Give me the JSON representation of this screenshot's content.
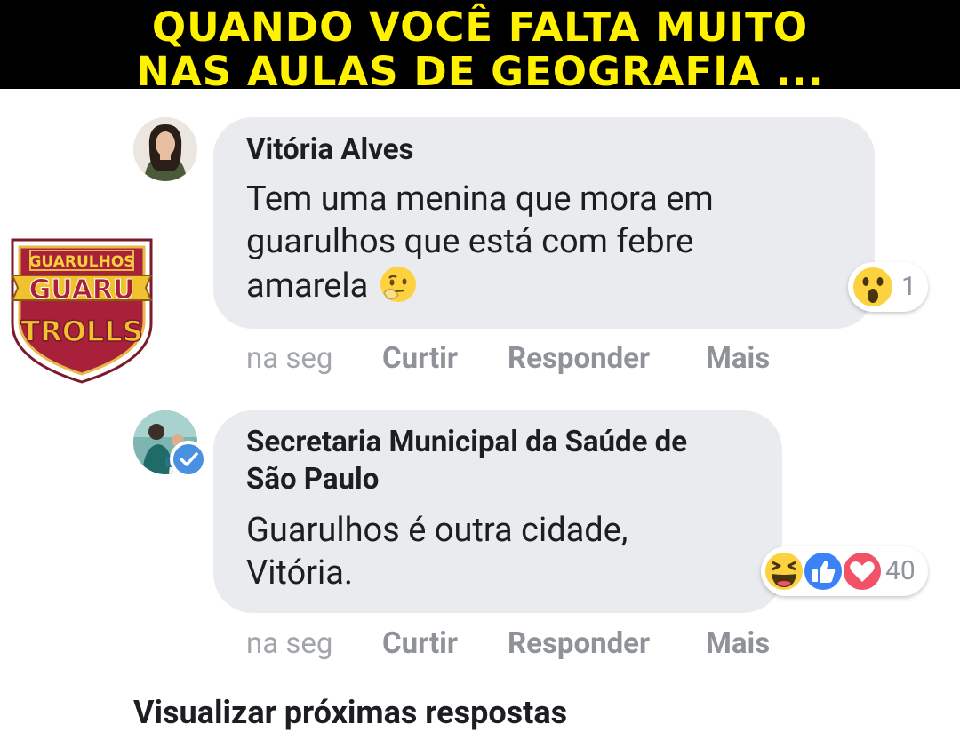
{
  "banner": {
    "line1": "QUANDO VOCÊ FALTA MUITO",
    "line2": "NAS AULAS DE GEOGRAFIA ..."
  },
  "watermark": {
    "top": "GUARULHOS",
    "middle": "GUARU",
    "bottom": "TROLLS"
  },
  "comments": [
    {
      "author": "Vitória Alves",
      "body_line1": "Tem uma menina que mora em",
      "body_line2": "guarulhos que está com febre",
      "body_line3": "amarela",
      "body_emoji": "thinking-face-icon",
      "reactions": [
        "wow-icon"
      ],
      "reaction_count": "1",
      "timestamp": "na seg",
      "like_label": "Curtir",
      "reply_label": "Responder",
      "more_label": "Mais"
    },
    {
      "author_line1": "Secretaria Municipal da Saúde de",
      "author_line2": "São Paulo",
      "verified": true,
      "body_line1": "Guarulhos é outra cidade,",
      "body_line2": "Vitória.",
      "reactions": [
        "haha-icon",
        "like-icon",
        "love-icon"
      ],
      "reaction_count": "40",
      "timestamp": "na seg",
      "like_label": "Curtir",
      "reply_label": "Responder",
      "more_label": "Mais"
    }
  ],
  "view_more": "Visualizar próximas respostas",
  "colors": {
    "banner_bg": "#000000",
    "banner_text": "#fff200",
    "bubble_bg": "#eaebee",
    "action_text": "#8f9298",
    "verified_badge": "#4a90e2"
  }
}
